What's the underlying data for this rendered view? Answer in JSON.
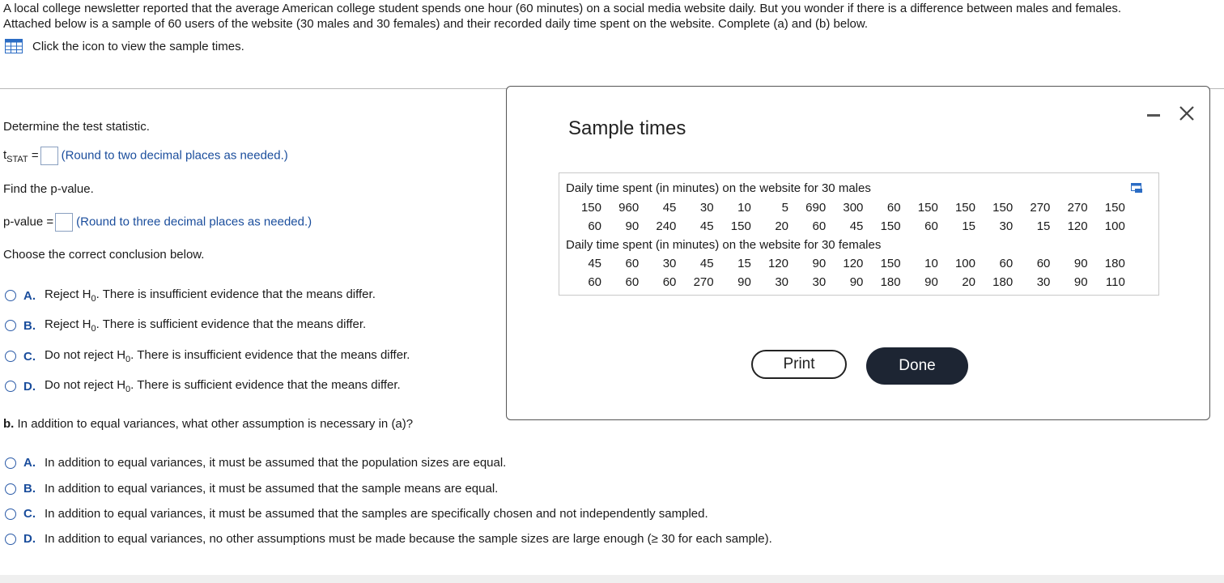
{
  "intro": {
    "line1": "A local college newsletter reported that the average American college student spends one hour (60 minutes) on a social media website daily. But you wonder if there is a difference between males and females.",
    "line2": "Attached below is a sample of 60 users of the website (30 males and 30 females) and their recorded daily time spent on the website. Complete (a) and (b) below.",
    "icon_link": "Click the icon to view the sample times."
  },
  "part_a": {
    "determine_stat": "Determine the test statistic.",
    "tstat_label_t": "t",
    "tstat_label_sub": "STAT",
    "tstat_eq": "=",
    "tstat_hint": "(Round to two decimal places as needed.)",
    "find_p": "Find the p-value.",
    "p_label": "p-value =",
    "p_hint": "(Round to three decimal places as needed.)",
    "choose": "Choose the correct conclusion below.",
    "options": [
      {
        "letter": "A.",
        "pre": "Reject H",
        "sub": "0",
        "post": ". There is insufficient evidence that the means differ."
      },
      {
        "letter": "B.",
        "pre": "Reject H",
        "sub": "0",
        "post": ". There is sufficient evidence that the means differ."
      },
      {
        "letter": "C.",
        "pre": "Do not reject H",
        "sub": "0",
        "post": ". There is insufficient evidence that the means differ."
      },
      {
        "letter": "D.",
        "pre": "Do not reject H",
        "sub": "0",
        "post": ". There is sufficient evidence that the means differ."
      }
    ]
  },
  "part_b": {
    "label": "b.",
    "question": "In addition to equal variances, what other assumption is necessary in (a)?",
    "options": [
      {
        "letter": "A.",
        "text": "In addition to equal variances, it must be assumed that the population sizes are equal."
      },
      {
        "letter": "B.",
        "text": "In addition to equal variances, it must be assumed that the sample means are equal."
      },
      {
        "letter": "C.",
        "text": "In addition to equal variances, it must be assumed that the samples are specifically chosen and not independently sampled."
      },
      {
        "letter": "D.",
        "text": "In addition to equal variances, no other assumptions must be made because the sample sizes are large enough (≥ 30 for each sample)."
      }
    ]
  },
  "modal": {
    "title": "Sample times",
    "males_heading": "Daily time spent (in minutes) on the website for 30 males",
    "males_row1": [
      "150",
      "960",
      "45",
      "30",
      "10",
      "5",
      "690",
      "300",
      "60",
      "150",
      "150",
      "150",
      "270",
      "270",
      "150"
    ],
    "males_row2": [
      "60",
      "90",
      "240",
      "45",
      "150",
      "20",
      "60",
      "45",
      "150",
      "60",
      "15",
      "30",
      "15",
      "120",
      "100"
    ],
    "females_heading": "Daily time spent (in minutes) on the website for 30 females",
    "females_row1": [
      "45",
      "60",
      "30",
      "45",
      "15",
      "120",
      "90",
      "120",
      "150",
      "10",
      "100",
      "60",
      "60",
      "90",
      "180"
    ],
    "females_row2": [
      "60",
      "60",
      "60",
      "270",
      "90",
      "30",
      "30",
      "90",
      "180",
      "90",
      "20",
      "180",
      "30",
      "90",
      "110"
    ],
    "print_label": "Print",
    "done_label": "Done"
  }
}
